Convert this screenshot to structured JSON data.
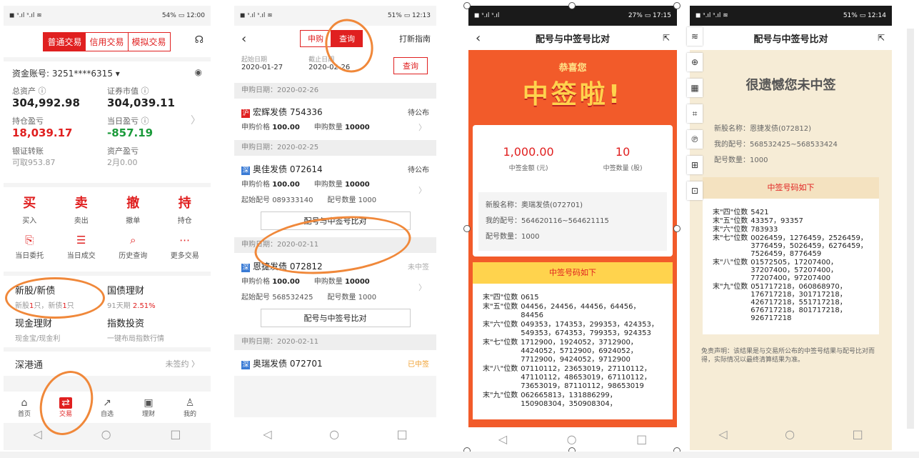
{
  "p1": {
    "status_left": "◼ ᵌ.ıl ᵌ.ıl ≋",
    "status_right": "54% ▭ 12:00",
    "tabs": [
      "普通交易",
      "信用交易",
      "模拟交易"
    ],
    "account_label": "资金账号:",
    "account_value": "3251****6315 ▾",
    "total_assets_label": "总资产 ⓘ",
    "total_assets": "304,992.98",
    "market_value_label": "证券市值 ⓘ",
    "market_value": "304,039.11",
    "position_pl_label": "持仓盈亏",
    "position_pl": "18,039.17",
    "today_pl_label": "当日盈亏 ⓘ",
    "today_pl": "-857.19",
    "transfer_label": "银证转账",
    "transfer_sub": "可取953.87",
    "asset_pl_label": "资产盈亏",
    "asset_pl_sub": "2月0.00",
    "actions_big": [
      {
        "g": "买",
        "l": "买入"
      },
      {
        "g": "卖",
        "l": "卖出"
      },
      {
        "g": "撤",
        "l": "撤单"
      },
      {
        "g": "持",
        "l": "持仓"
      }
    ],
    "actions_icon": [
      {
        "g": "⎘",
        "l": "当日委托"
      },
      {
        "g": "☰",
        "l": "当日成交"
      },
      {
        "g": "⌕",
        "l": "历史查询"
      },
      {
        "g": "⋯",
        "l": "更多交易"
      }
    ],
    "fin": [
      {
        "t": "新股/新债",
        "s_pre": "新股",
        "s_n1": "1",
        "s_mid": "只，新债",
        "s_n2": "1",
        "s_post": "只"
      },
      {
        "t": "国债理财",
        "s_pre": "91天期 ",
        "s_n1": "2.51%",
        "s_mid": "",
        "s_n2": "",
        "s_post": ""
      },
      {
        "t": "现金理财",
        "s_pre": "现金宝/现金利",
        "s_n1": "",
        "s_mid": "",
        "s_n2": "",
        "s_post": ""
      },
      {
        "t": "指数投资",
        "s_pre": "一键布局指数行情",
        "s_n1": "",
        "s_mid": "",
        "s_n2": "",
        "s_post": ""
      }
    ],
    "shg": "深港通",
    "shg_status": "未签约 〉",
    "bottom": [
      {
        "g": "⌂",
        "l": "首页"
      },
      {
        "g": "⇄",
        "l": "交易"
      },
      {
        "g": "↗",
        "l": "自选"
      },
      {
        "g": "▣",
        "l": "理财"
      },
      {
        "g": "♙",
        "l": "我的"
      }
    ]
  },
  "p2": {
    "status_left": "◼ ᵌ.ıl ᵌ.ıl ≋",
    "status_right": "51% ▭ 12:13",
    "seg1": "申购",
    "seg2": "查询",
    "guide": "打新指南",
    "start_label": "起始日期",
    "start": "2020-01-27",
    "end_label": "截止日期",
    "end": "2020-02-26",
    "query": "查询",
    "sections": [
      {
        "date": "申购日期：2020-02-26",
        "badge": "沪",
        "name": "宏辉发债 754336",
        "status": "待公布",
        "price_label": "申购价格",
        "price": "100.00",
        "qty_label": "申购数量",
        "qty": "10000",
        "start_no_label": "",
        "start_no": "",
        "qty2_label": "",
        "qty2": "",
        "compare": ""
      },
      {
        "date": "申购日期：2020-02-25",
        "badge": "深",
        "name": "奥佳发债 072614",
        "status": "待公布",
        "price_label": "申购价格",
        "price": "100.00",
        "qty_label": "申购数量",
        "qty": "10000",
        "start_no_label": "起始配号",
        "start_no": "089333140",
        "qty2_label": "配号数量",
        "qty2": "1000",
        "compare": "配号与中签号比对"
      },
      {
        "date": "申购日期：2020-02-11",
        "badge": "深",
        "name": "恩捷发债 072812",
        "status": "未中签",
        "price_label": "申购价格",
        "price": "100.00",
        "qty_label": "申购数量",
        "qty": "10000",
        "start_no_label": "起始配号",
        "start_no": "568532425",
        "qty2_label": "配号数量",
        "qty2": "1000",
        "compare": "配号与中签号比对"
      },
      {
        "date": "申购日期：2020-02-11",
        "badge": "深",
        "name": "奥瑞发债 072701",
        "status": "已中签",
        "price_label": "",
        "price": "",
        "qty_label": "",
        "qty": "",
        "start_no_label": "",
        "start_no": "",
        "qty2_label": "",
        "qty2": "",
        "compare": ""
      }
    ]
  },
  "p3": {
    "status_left": "◼ ᵌ.ıl ᵌ.ıl",
    "status_right": "27% ▭ 17:15",
    "title": "配号与中签号比对",
    "congrats": "恭喜您",
    "hit": "中签啦!",
    "amount": "1,000.00",
    "amount_label": "中签金额 (元)",
    "count": "10",
    "count_label": "中签数量 (股)",
    "name_label": "新股名称：",
    "name": "奥瑞发债(072701)",
    "my_label": "我的配号：",
    "my": "564620116~564621115",
    "qty_label": "配号数量：",
    "qty": "1000",
    "win_head": "中签号码如下",
    "wins": [
      {
        "l": "末\"四\"位数",
        "v": "0615"
      },
      {
        "l": "末\"五\"位数",
        "v": "04456，24456，44456，64456，84456"
      },
      {
        "l": "末\"六\"位数",
        "v": "049353，174353，299353，424353，549353，674353，799353，924353"
      },
      {
        "l": "末\"七\"位数",
        "v": "1712900，1924052，3712900，4424052，5712900，6924052，7712900，9424052，9712900"
      },
      {
        "l": "末\"八\"位数",
        "v": "07110112，23653019，27110112，47110112，48653019，67110112，73653019，87110112，98653019"
      },
      {
        "l": "末\"九\"位数",
        "v": "062665813，131886299，150908304，350908304，"
      }
    ]
  },
  "p4": {
    "status_left": "◼ ᵌ.ıl ᵌ.ıl ≋",
    "status_right": "51% ▭ 12:14",
    "title": "配号与中签号比对",
    "sorry": "很遗憾您未中签",
    "name_label": "新股名称：",
    "name": "恩捷发债(072812)",
    "my_label": "我的配号：",
    "my": "568532425~568533424",
    "qty_label": "配号数量：",
    "qty": "1000",
    "win_head": "中签号码如下",
    "wins": [
      {
        "l": "末\"四\"位数",
        "v": "5421"
      },
      {
        "l": "末\"五\"位数",
        "v": "43357，93357"
      },
      {
        "l": "末\"六\"位数",
        "v": "783933"
      },
      {
        "l": "末\"七\"位数",
        "v": "0026459，1276459，2526459，3776459，5026459，6276459，7526459，8776459"
      },
      {
        "l": "末\"八\"位数",
        "v": "01572505，17207400，37207400，57207400，77207400，97207400"
      },
      {
        "l": "末\"九\"位数",
        "v": "051717218，060868970，176717218，301717218，426717218，551717218，676717218，801717218，926717218"
      }
    ],
    "disclaimer": "免责声明：该结果是与交易所公布的中签号结果与配号比对而得，实际情况以最终清算结果为准。",
    "tools": [
      "≋",
      "⊕",
      "▦",
      "⌗",
      "℗",
      "⊞",
      "⊡"
    ]
  },
  "nav": [
    "◁",
    "○",
    "□"
  ]
}
